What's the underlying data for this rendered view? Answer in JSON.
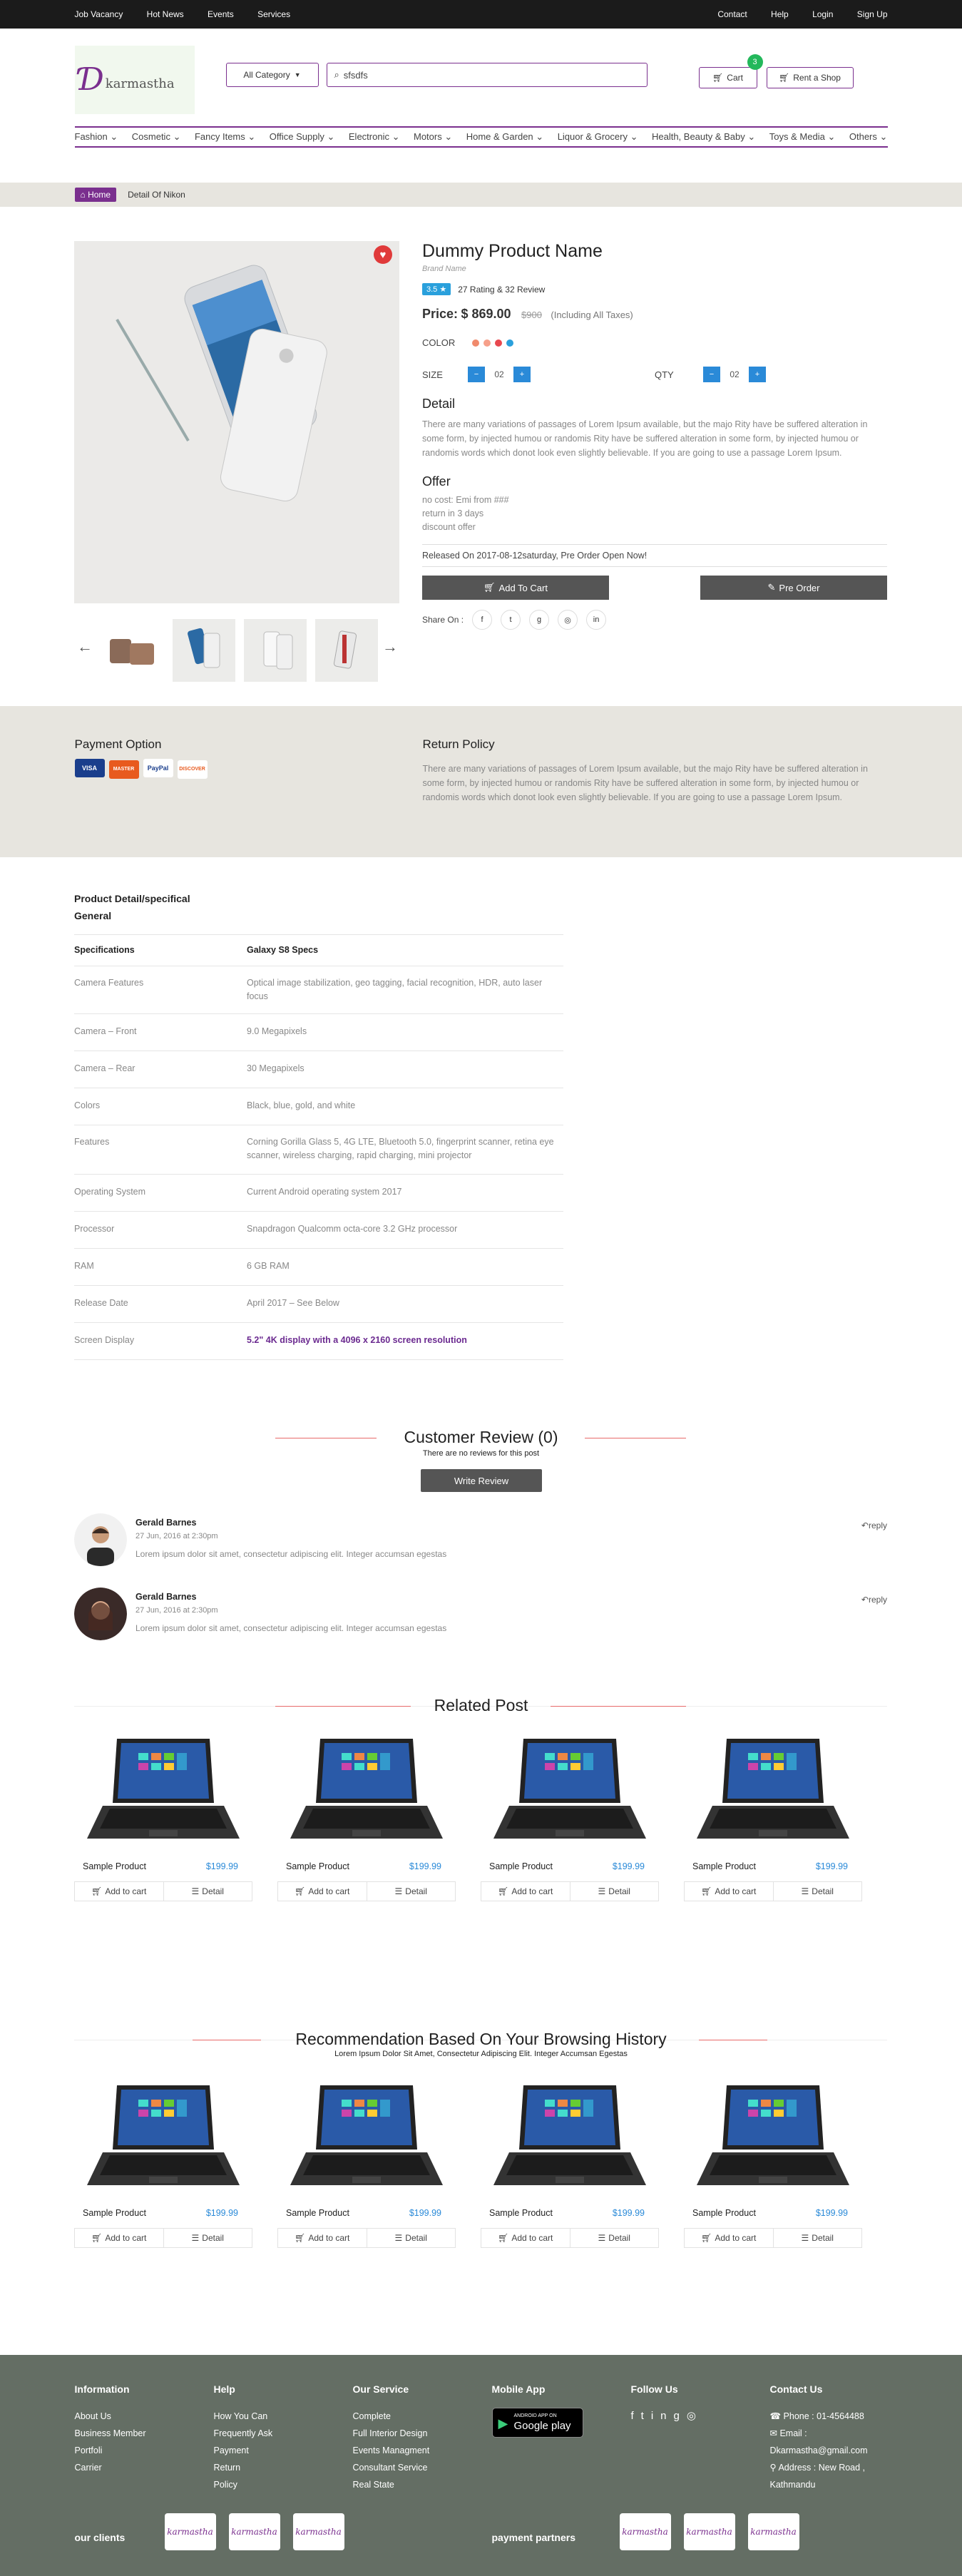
{
  "topbar": {
    "left": [
      "Job Vacancy",
      "Hot News",
      "Events",
      "Services"
    ],
    "right": [
      "Contact",
      "Help",
      "Login",
      "Sign Up"
    ]
  },
  "header": {
    "logo_text": "karmastha",
    "category": "All Category",
    "search_value": "sfsdfs",
    "cart_label": "Cart",
    "cart_count": "3",
    "shop_label": "Rent a Shop"
  },
  "nav": [
    "Fashion",
    "Cosmetic",
    "Fancy Items",
    "Office Supply",
    "Electronic",
    "Motors",
    "Home & Garden",
    "Liquor & Grocery",
    "Health, Beauty & Baby",
    "Toys & Media",
    "Others"
  ],
  "breadcrumb": {
    "home": "Home",
    "current": "Detail Of Nikon"
  },
  "product": {
    "title": "Dummy Product Name",
    "brand": "Brand Name",
    "rating": "3.5",
    "rating_text": "27 Rating & 32 Review",
    "price_label": "Price:",
    "price": "$ 869.00",
    "old_price": "$900",
    "taxes": "(Including All Taxes)",
    "color_label": "COLOR",
    "colors": [
      "#f08a6c",
      "#f6a08a",
      "#e8484f",
      "#2aa0dc"
    ],
    "size_label": "SIZE",
    "size_value": "02",
    "qty_label": "QTY",
    "qty_value": "02",
    "detail_title": "Detail",
    "detail_text": "There are many variations of passages of Lorem Ipsum available, but the majo Rity have be suffered alteration in some form, by injected humou or randomis Rity have be suffered alteration in some form, by injected humou or randomis words which donot look even slightly believable. If you are going to use a passage Lorem Ipsum.",
    "offer_title": "Offer",
    "offers": [
      "no cost: Emi from ###",
      "return in 3 days",
      "discount offer"
    ],
    "released": "Released On 2017-08-12saturday, Pre Order Open Now!",
    "add_to_cart": "Add To Cart",
    "pre_order": "Pre Order",
    "share_label": "Share On :"
  },
  "payment": {
    "title": "Payment Option",
    "cards": [
      "VISA",
      "MASTER",
      "PayPal",
      "DISCOVER"
    ],
    "return_title": "Return Policy",
    "return_text": "There are many variations of passages of Lorem Ipsum available, but the majo Rity have be suffered alteration in some form, by injected humou or randomis Rity have be suffered alteration in some form, by injected humou or randomis words which donot look even slightly believable. If you are going to use a passage Lorem Ipsum."
  },
  "specs": {
    "title": "Product Detail/specifical",
    "subtitle": "General",
    "head": [
      "Specifications",
      "Galaxy S8 Specs"
    ],
    "rows": [
      [
        "Camera Features",
        "Optical image stabilization, geo tagging, facial recognition, HDR, auto laser focus"
      ],
      [
        "Camera – Front",
        "9.0 Megapixels"
      ],
      [
        "Camera – Rear",
        "30 Megapixels"
      ],
      [
        "Colors",
        "Black, blue, gold, and white"
      ],
      [
        "Features",
        "Corning Gorilla Glass 5, 4G LTE, Bluetooth 5.0, fingerprint scanner, retina eye scanner, wireless charging, rapid charging, mini projector"
      ],
      [
        "Operating System",
        "Current Android operating system 2017"
      ],
      [
        "Processor",
        "Snapdragon Qualcomm octa-core 3.2 GHz processor"
      ],
      [
        "RAM",
        "6 GB RAM"
      ],
      [
        "Release Date",
        "April 2017 – See Below"
      ],
      [
        "Screen Display",
        "5.2\" 4K display with a 4096 x 2160 screen resolution"
      ]
    ]
  },
  "reviews": {
    "title": "Customer Review (0)",
    "subtitle": "There are no reviews for this post",
    "write": "Write Review",
    "items": [
      {
        "name": "Gerald Barnes",
        "date": "27 Jun, 2016 at 2:30pm",
        "text": "Lorem ipsum dolor sit amet, consectetur adipiscing elit. Integer accumsan egestas",
        "reply": "reply"
      },
      {
        "name": "Gerald Barnes",
        "date": "27 Jun, 2016 at 2:30pm",
        "text": "Lorem ipsum dolor sit amet, consectetur adipiscing elit. Integer accumsan egestas",
        "reply": "reply"
      }
    ]
  },
  "related": {
    "title": "Related Post",
    "items": [
      {
        "name": "Sample Product",
        "price": "$199.99",
        "cart": "Add to cart",
        "detail": "Detail"
      },
      {
        "name": "Sample Product",
        "price": "$199.99",
        "cart": "Add to cart",
        "detail": "Detail"
      },
      {
        "name": "Sample Product",
        "price": "$199.99",
        "cart": "Add to cart",
        "detail": "Detail"
      },
      {
        "name": "Sample Product",
        "price": "$199.99",
        "cart": "Add to cart",
        "detail": "Detail"
      }
    ]
  },
  "recommend": {
    "title": "Recommendation Based On Your Browsing History",
    "subtitle": "Lorem Ipsum Dolor Sit Amet, Consectetur Adipiscing Elit. Integer Accumsan Egestas",
    "items": [
      {
        "name": "Sample Product",
        "price": "$199.99",
        "cart": "Add to cart",
        "detail": "Detail"
      },
      {
        "name": "Sample Product",
        "price": "$199.99",
        "cart": "Add to cart",
        "detail": "Detail"
      },
      {
        "name": "Sample Product",
        "price": "$199.99",
        "cart": "Add to cart",
        "detail": "Detail"
      },
      {
        "name": "Sample Product",
        "price": "$199.99",
        "cart": "Add to cart",
        "detail": "Detail"
      }
    ]
  },
  "footer": {
    "information": {
      "title": "Information",
      "items": [
        "About Us",
        "Business Member",
        "Portfoli",
        "Carrier"
      ]
    },
    "help": {
      "title": "Help",
      "items": [
        "How You Can",
        "Frequently Ask",
        "Payment",
        "Return",
        "Policy"
      ]
    },
    "service": {
      "title": "Our Service",
      "items": [
        "Complete",
        "Full Interior Design",
        "Events Managment",
        "Consultant Service",
        "Real State"
      ]
    },
    "mobile": {
      "title": "Mobile App",
      "small": "ANDROID APP ON",
      "big": "Google play"
    },
    "follow": {
      "title": "Follow Us"
    },
    "contact": {
      "title": "Contact Us",
      "phone": "Phone : 01-4564488",
      "email_label": "Email :",
      "email": "Dkarmastha@gmail.com",
      "address": "Address : New Road ,",
      "city": "Kathmandu"
    },
    "clients": "our clients",
    "partners": "payment partners",
    "logo_text": "karmastha"
  }
}
